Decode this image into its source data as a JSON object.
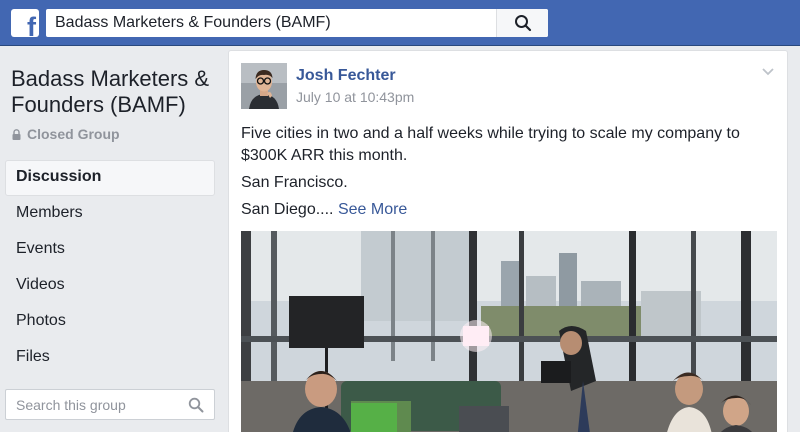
{
  "topbar": {
    "logo_letter": "f",
    "search_value": "Badass Marketers & Founders (BAMF)"
  },
  "group": {
    "name": "Badass Marketers & Founders (BAMF)",
    "privacy": "Closed Group"
  },
  "nav": {
    "items": [
      {
        "label": "Discussion",
        "active": true
      },
      {
        "label": "Members"
      },
      {
        "label": "Events"
      },
      {
        "label": "Videos"
      },
      {
        "label": "Photos"
      },
      {
        "label": "Files"
      }
    ]
  },
  "group_search": {
    "placeholder": "Search this group"
  },
  "post": {
    "author": "Josh Fechter",
    "timestamp": "July 10 at 10:43pm",
    "paragraphs": [
      "Five cities in two and a half weeks while trying to scale my company to $300K ARR this month.",
      "San Francisco."
    ],
    "last_line": "San Diego....",
    "see_more": "See More"
  },
  "colors": {
    "brand": "#4267b2",
    "link": "#385898",
    "page_bg": "#e9ebee"
  },
  "icons": [
    "search-icon",
    "lock-icon",
    "chevron-down-icon"
  ]
}
